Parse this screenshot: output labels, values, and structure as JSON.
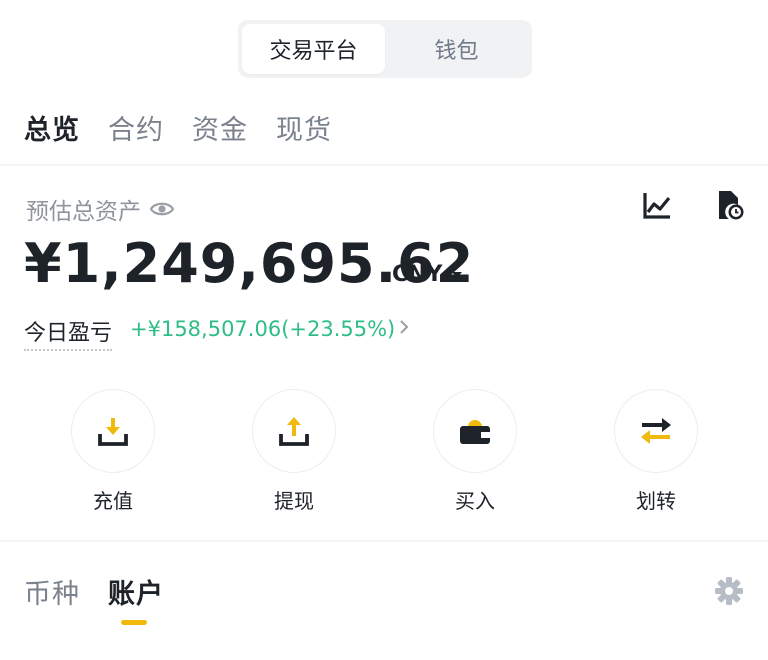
{
  "segment": {
    "active": "交易平台",
    "inactive": "钱包"
  },
  "subtabs": [
    {
      "label": "总览",
      "active": true
    },
    {
      "label": "合约",
      "active": false
    },
    {
      "label": "资金",
      "active": false
    },
    {
      "label": "现货",
      "active": false
    }
  ],
  "overview": {
    "asset_label": "预估总资产",
    "balance": "¥1,249,695.62",
    "currency": "CNY",
    "pnl_label": "今日盈亏",
    "pnl_value": "+¥158,507.06(+23.55%)"
  },
  "actions": [
    {
      "label": "充值",
      "icon": "deposit-icon"
    },
    {
      "label": "提现",
      "icon": "withdraw-icon"
    },
    {
      "label": "买入",
      "icon": "buy-icon"
    },
    {
      "label": "划转",
      "icon": "transfer-icon"
    }
  ],
  "bottom_tabs": [
    {
      "label": "币种",
      "active": false
    },
    {
      "label": "账户",
      "active": true
    }
  ],
  "colors": {
    "accent": "#F0B90B",
    "positive": "#2EBD85",
    "text": "#1E2329",
    "muted": "#8F959C"
  }
}
